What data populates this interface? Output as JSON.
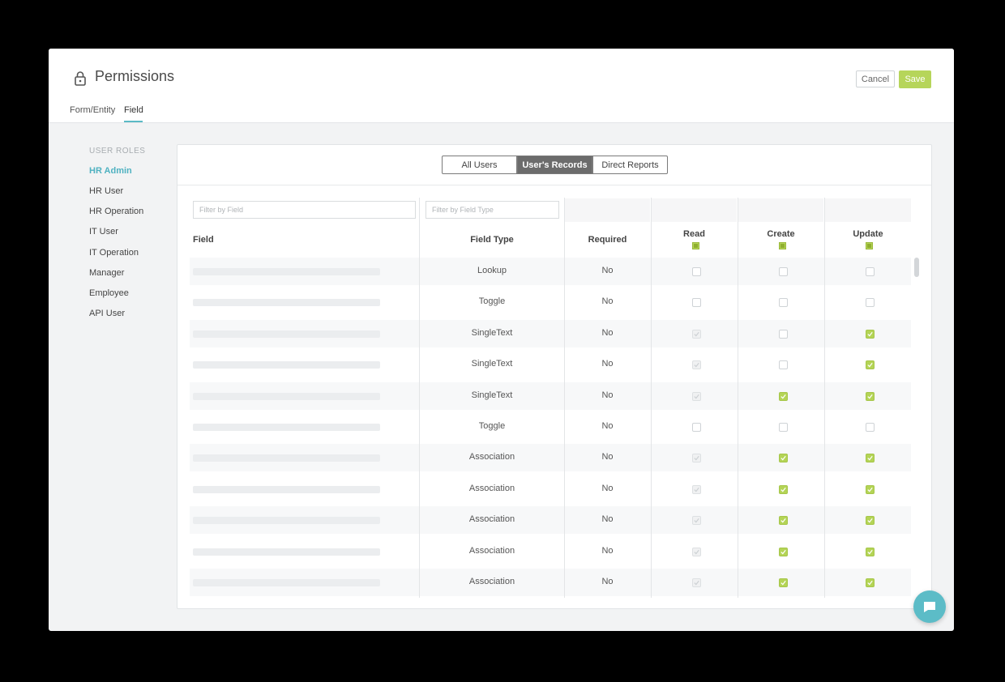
{
  "header": {
    "title": "Permissions",
    "cancel_label": "Cancel",
    "save_label": "Save"
  },
  "tabs": [
    {
      "label": "Form/Entity"
    },
    {
      "label": "Field"
    }
  ],
  "sidebar": {
    "heading": "USER ROLES",
    "items": [
      {
        "label": "HR Admin",
        "active": true
      },
      {
        "label": "HR User"
      },
      {
        "label": "HR Operation"
      },
      {
        "label": "IT User"
      },
      {
        "label": "IT Operation"
      },
      {
        "label": "Manager"
      },
      {
        "label": "Employee"
      },
      {
        "label": "API User"
      }
    ]
  },
  "segments": [
    {
      "label": "All Users"
    },
    {
      "label": "User's Records",
      "active": true
    },
    {
      "label": "Direct Reports"
    }
  ],
  "filters": {
    "field_placeholder": "Filter by Field",
    "type_placeholder": "Filter by Field Type"
  },
  "columns": {
    "field": "Field",
    "field_type": "Field Type",
    "required": "Required",
    "read": "Read",
    "create": "Create",
    "update": "Update"
  },
  "rows": [
    {
      "type": "Lookup",
      "required": "No",
      "read": "off",
      "create": "off",
      "update": "off"
    },
    {
      "type": "Toggle",
      "required": "No",
      "read": "off",
      "create": "off",
      "update": "off"
    },
    {
      "type": "SingleText",
      "required": "No",
      "read": "disabled",
      "create": "off",
      "update": "on"
    },
    {
      "type": "SingleText",
      "required": "No",
      "read": "disabled",
      "create": "off",
      "update": "on"
    },
    {
      "type": "SingleText",
      "required": "No",
      "read": "disabled",
      "create": "on",
      "update": "on"
    },
    {
      "type": "Toggle",
      "required": "No",
      "read": "off",
      "create": "off",
      "update": "off"
    },
    {
      "type": "Association",
      "required": "No",
      "read": "disabled",
      "create": "on",
      "update": "on"
    },
    {
      "type": "Association",
      "required": "No",
      "read": "disabled",
      "create": "on",
      "update": "on"
    },
    {
      "type": "Association",
      "required": "No",
      "read": "disabled",
      "create": "on",
      "update": "on"
    },
    {
      "type": "Association",
      "required": "No",
      "read": "disabled",
      "create": "on",
      "update": "on"
    },
    {
      "type": "Association",
      "required": "No",
      "read": "disabled",
      "create": "on",
      "update": "on"
    }
  ],
  "colors": {
    "accent": "#5bbac6",
    "save": "#b6d55a",
    "check": "#b4d456"
  }
}
